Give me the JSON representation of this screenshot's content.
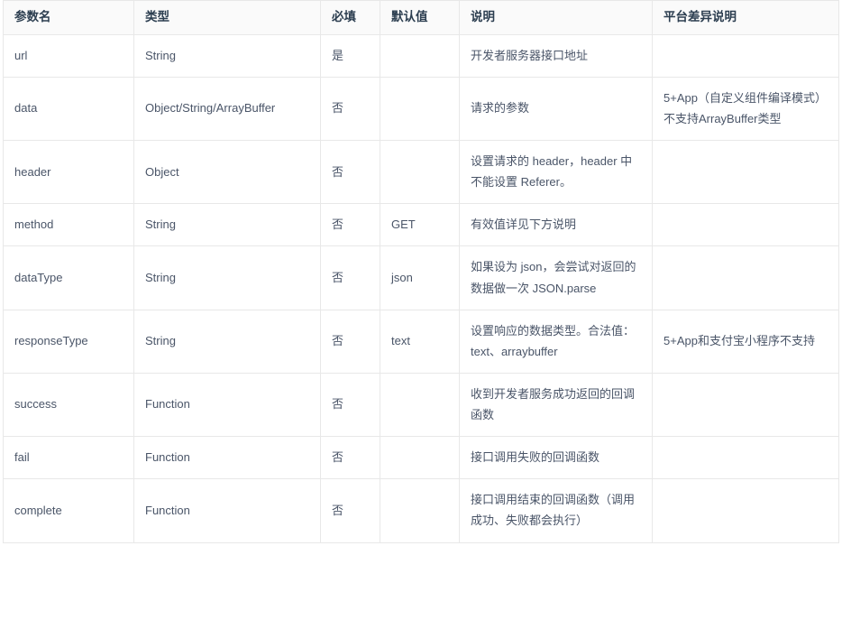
{
  "table": {
    "caption": "",
    "columns": [
      {
        "key": "name",
        "label": "参数名"
      },
      {
        "key": "type",
        "label": "类型"
      },
      {
        "key": "required",
        "label": "必填"
      },
      {
        "key": "default",
        "label": "默认值"
      },
      {
        "key": "desc",
        "label": "说明"
      },
      {
        "key": "platform",
        "label": "平台差异说明"
      }
    ],
    "rows": [
      {
        "name": "url",
        "type": "String",
        "required": "是",
        "default": "",
        "desc": "开发者服务器接口地址",
        "platform": ""
      },
      {
        "name": "data",
        "type": "Object/String/ArrayBuffer",
        "required": "否",
        "default": "",
        "desc": "请求的参数",
        "platform": "5+App（自定义组件编译模式）不支持ArrayBuffer类型"
      },
      {
        "name": "header",
        "type": "Object",
        "required": "否",
        "default": "",
        "desc": "设置请求的 header，header 中不能设置 Referer。",
        "platform": ""
      },
      {
        "name": "method",
        "type": "String",
        "required": "否",
        "default": "GET",
        "desc": "有效值详见下方说明",
        "platform": ""
      },
      {
        "name": "dataType",
        "type": "String",
        "required": "否",
        "default": "json",
        "desc": "如果设为 json，会尝试对返回的数据做一次 JSON.parse",
        "platform": ""
      },
      {
        "name": "responseType",
        "type": "String",
        "required": "否",
        "default": "text",
        "desc": "设置响应的数据类型。合法值：text、arraybuffer",
        "platform": "5+App和支付宝小程序不支持"
      },
      {
        "name": "success",
        "type": "Function",
        "required": "否",
        "default": "",
        "desc": "收到开发者服务成功返回的回调函数",
        "platform": ""
      },
      {
        "name": "fail",
        "type": "Function",
        "required": "否",
        "default": "",
        "desc": "接口调用失败的回调函数",
        "platform": ""
      },
      {
        "name": "complete",
        "type": "Function",
        "required": "否",
        "default": "",
        "desc": "接口调用结束的回调函数（调用成功、失败都会执行）",
        "platform": ""
      }
    ]
  },
  "colors": {
    "header_background": "#fafafa",
    "border": "#e8e8e8",
    "text": "#50607a",
    "page_background": "#ffffff"
  }
}
